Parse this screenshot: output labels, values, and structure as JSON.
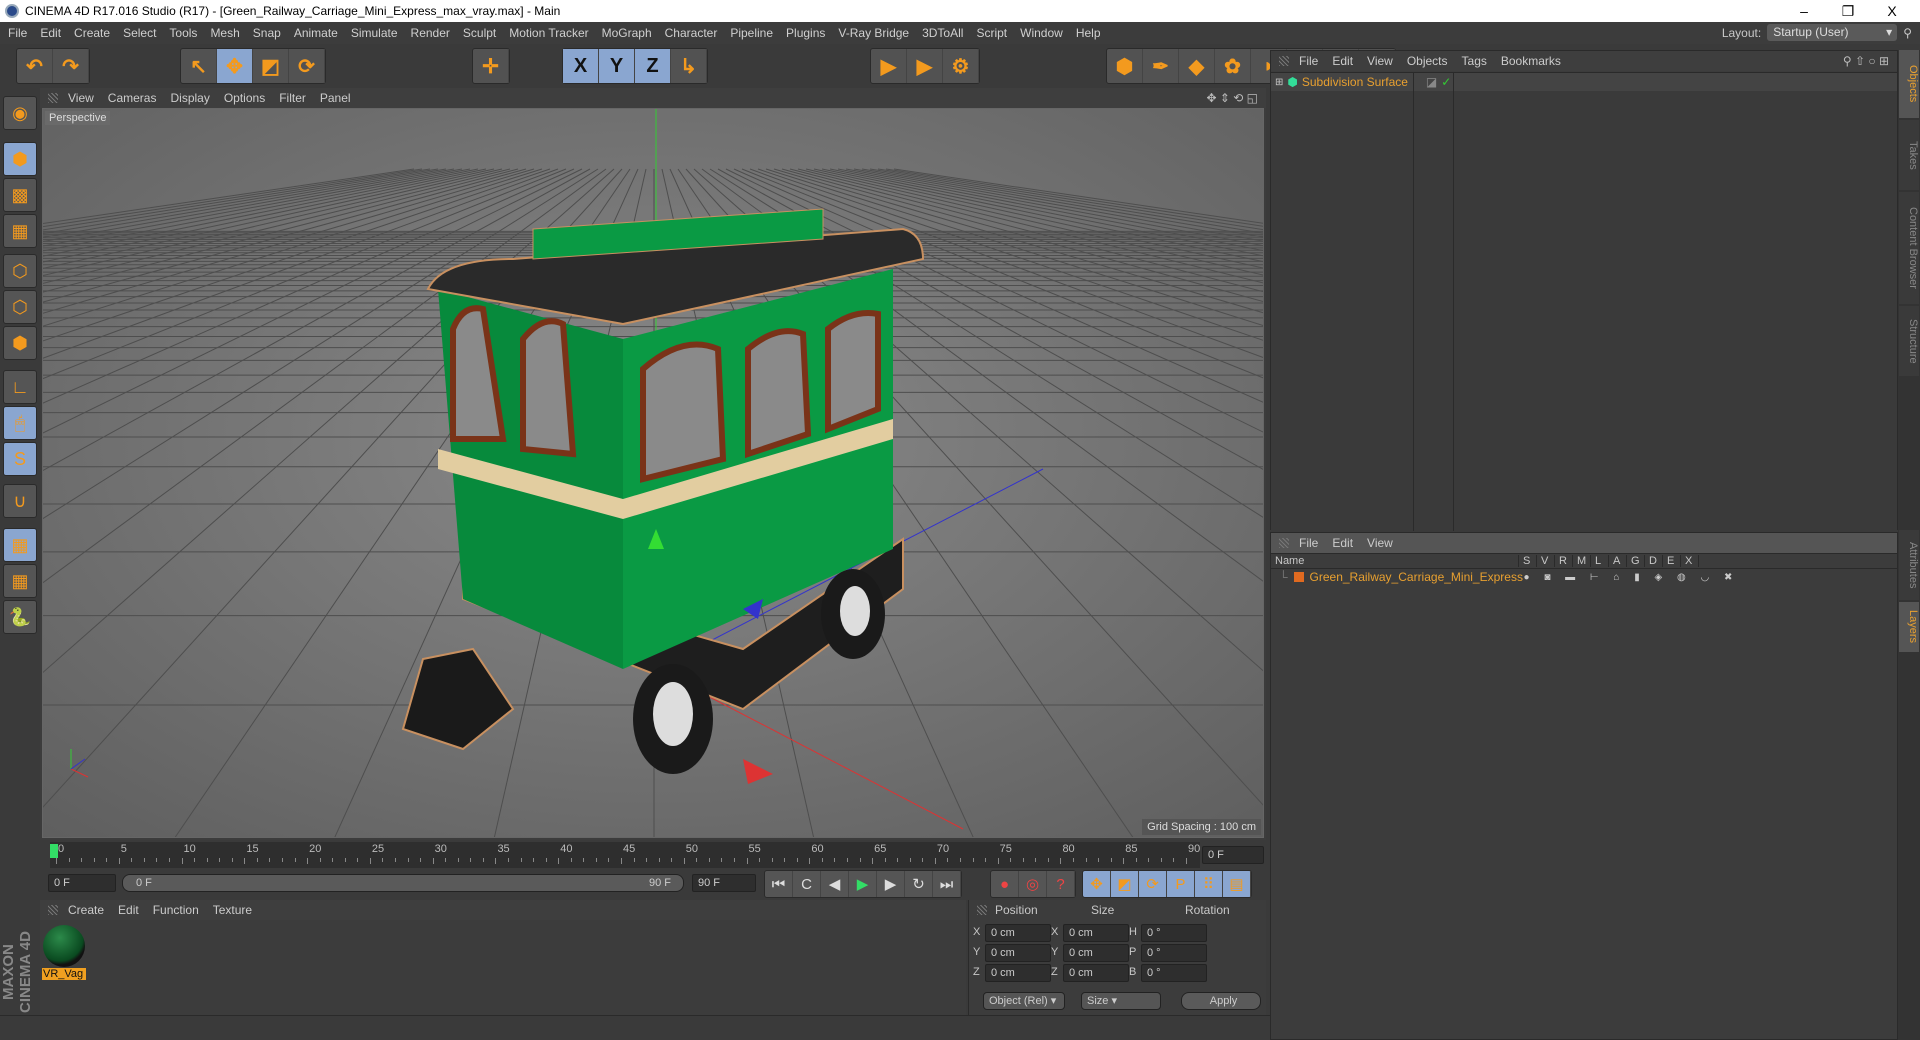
{
  "window": {
    "title": "CINEMA 4D R17.016 Studio (R17) - [Green_Railway_Carriage_Mini_Express_max_vray.max] - Main",
    "minimize": "–",
    "restore": "❐",
    "close": "X"
  },
  "menu": [
    "File",
    "Edit",
    "Create",
    "Select",
    "Tools",
    "Mesh",
    "Snap",
    "Animate",
    "Simulate",
    "Render",
    "Sculpt",
    "Motion Tracker",
    "MoGraph",
    "Character",
    "Pipeline",
    "Plugins",
    "V-Ray Bridge",
    "3DToAll",
    "Script",
    "Window",
    "Help"
  ],
  "layout": {
    "label": "Layout:",
    "value": "Startup (User)"
  },
  "toolbar": {
    "groups": [
      [
        {
          "icon": "undo-icon",
          "glyph": "↶"
        },
        {
          "icon": "redo-icon",
          "glyph": "↷"
        }
      ],
      [
        {
          "icon": "select-icon",
          "glyph": "↖",
          "on": false
        },
        {
          "icon": "move-icon",
          "glyph": "✥",
          "on": true
        },
        {
          "icon": "scale-icon",
          "glyph": "◩",
          "on": false
        },
        {
          "icon": "rotate-icon",
          "glyph": "⟳",
          "on": false
        }
      ],
      [
        {
          "icon": "transform-icon",
          "glyph": "✛"
        }
      ],
      [
        {
          "icon": "x-axis-icon",
          "glyph": "X",
          "on": true
        },
        {
          "icon": "y-axis-icon",
          "glyph": "Y",
          "on": true
        },
        {
          "icon": "z-axis-icon",
          "glyph": "Z",
          "on": true
        },
        {
          "icon": "coordinate-system-icon",
          "glyph": "↳"
        }
      ],
      [
        {
          "icon": "render-view-icon",
          "glyph": "▶"
        },
        {
          "icon": "render-picture-viewer-icon",
          "glyph": "▶"
        },
        {
          "icon": "render-settings-icon",
          "glyph": "⚙"
        }
      ],
      [
        {
          "icon": "cube-icon",
          "glyph": "⬢"
        },
        {
          "icon": "pen-spline-icon",
          "glyph": "✒"
        },
        {
          "icon": "subdivision-icon",
          "glyph": "◆"
        },
        {
          "icon": "cloner-icon",
          "glyph": "✿"
        },
        {
          "icon": "deformer-icon",
          "glyph": "◗"
        },
        {
          "icon": "floor-icon",
          "glyph": "▦"
        },
        {
          "icon": "camera-icon",
          "glyph": "🎥"
        },
        {
          "icon": "light-icon",
          "glyph": "💡"
        }
      ]
    ]
  },
  "left_tools": [
    {
      "icon": "make-editable-icon",
      "glyph": "◉"
    },
    {
      "icon": "model-mode-icon",
      "glyph": "⬢",
      "on": true
    },
    {
      "icon": "texture-mode-icon",
      "glyph": "▩"
    },
    {
      "icon": "workplane-icon",
      "glyph": "▦"
    },
    {
      "icon": "points-mode-icon",
      "glyph": "⬡"
    },
    {
      "icon": "edges-mode-icon",
      "glyph": "⬡"
    },
    {
      "icon": "polygons-mode-icon",
      "glyph": "⬢"
    },
    {
      "icon": "axis-icon",
      "glyph": "∟"
    },
    {
      "icon": "tweak-icon",
      "glyph": "🖱",
      "on": true
    },
    {
      "icon": "solo-icon",
      "glyph": "S",
      "on": true
    },
    {
      "icon": "magnet-icon",
      "glyph": "∪"
    },
    {
      "icon": "lock-workplane-icon",
      "glyph": "▦",
      "on": true
    },
    {
      "icon": "workplane-align-icon",
      "glyph": "▦"
    },
    {
      "icon": "python-icon",
      "glyph": "🐍"
    }
  ],
  "viewport": {
    "menu": [
      "View",
      "Cameras",
      "Display",
      "Options",
      "Filter",
      "Panel"
    ],
    "label": "Perspective",
    "grid_spacing": "Grid Spacing : 100 cm"
  },
  "timeline": {
    "ticks": [
      "0",
      "5",
      "10",
      "15",
      "20",
      "25",
      "30",
      "35",
      "40",
      "45",
      "50",
      "55",
      "60",
      "65",
      "70",
      "75",
      "80",
      "85",
      "90"
    ],
    "current_frame": "0 F",
    "start": "0 F",
    "range_start": "0 F",
    "range_end": "90 F",
    "end": "90 F"
  },
  "playback": [
    {
      "icon": "go-start-icon",
      "glyph": "⏮"
    },
    {
      "icon": "prev-key-icon",
      "glyph": "C"
    },
    {
      "icon": "prev-frame-icon",
      "glyph": "◀"
    },
    {
      "icon": "play-icon",
      "glyph": "▶"
    },
    {
      "icon": "next-frame-icon",
      "glyph": "▶"
    },
    {
      "icon": "next-key-icon",
      "glyph": "↻"
    },
    {
      "icon": "go-end-icon",
      "glyph": "⏭"
    }
  ],
  "record": [
    {
      "icon": "record-icon",
      "glyph": "●"
    },
    {
      "icon": "autokey-icon",
      "glyph": "◎"
    },
    {
      "icon": "keyframe-selection-icon",
      "glyph": "?"
    }
  ],
  "key_tracks": [
    {
      "icon": "key-position-icon",
      "glyph": "✥"
    },
    {
      "icon": "key-scale-icon",
      "glyph": "◩"
    },
    {
      "icon": "key-rotation-icon",
      "glyph": "⟳"
    },
    {
      "icon": "key-param-icon",
      "glyph": "P"
    },
    {
      "icon": "key-pla-icon",
      "glyph": "⠿"
    },
    {
      "icon": "timeline-icon",
      "glyph": "▤"
    }
  ],
  "materials": {
    "menu": [
      "Create",
      "Edit",
      "Function",
      "Texture"
    ],
    "items": [
      {
        "name": "VR_Vag"
      }
    ]
  },
  "brand": "MAXON CINEMA 4D",
  "coords": {
    "headers": [
      "Position",
      "Size",
      "Rotation"
    ],
    "rows": [
      {
        "pl": "X",
        "p": "0 cm",
        "sl": "X",
        "s": "0 cm",
        "rl": "H",
        "r": "0 °"
      },
      {
        "pl": "Y",
        "p": "0 cm",
        "sl": "Y",
        "s": "0 cm",
        "rl": "P",
        "r": "0 °"
      },
      {
        "pl": "Z",
        "p": "0 cm",
        "sl": "Z",
        "s": "0 cm",
        "rl": "B",
        "r": "0 °"
      }
    ],
    "mode": "Object (Rel)",
    "size_mode": "Size",
    "apply": "Apply"
  },
  "objects": {
    "menu": [
      "File",
      "Edit",
      "View",
      "Objects",
      "Tags",
      "Bookmarks"
    ],
    "items": [
      {
        "name": "Subdivision Surface"
      }
    ]
  },
  "layers": {
    "menu": [
      "File",
      "Edit",
      "View"
    ],
    "columns": [
      "Name",
      "S",
      "V",
      "R",
      "M",
      "L",
      "A",
      "G",
      "D",
      "E",
      "X"
    ],
    "items": [
      {
        "name": "Green_Railway_Carriage_Mini_Express",
        "color": "#e06a20"
      }
    ]
  },
  "right_tabs": [
    "Objects",
    "Takes",
    "Content Browser",
    "Structure",
    "Attributes",
    "Layers"
  ],
  "colors": {
    "accent": "#e8a030",
    "active": "#8aa6d0",
    "model_green": "#0b8a3e"
  }
}
